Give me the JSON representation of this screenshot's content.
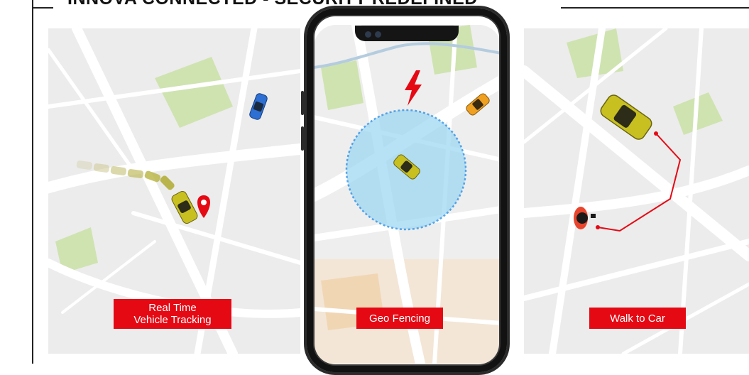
{
  "header": {
    "title": "INNOVA CONNECTED - SECURITY REDEFINED"
  },
  "features": [
    {
      "label_line1": "Real Time",
      "label_line2": "Vehicle Tracking"
    },
    {
      "label": "Geo Fencing"
    },
    {
      "label": "Walk to Car"
    }
  ],
  "colors": {
    "accent_red": "#e50914",
    "map_background": "#ececec",
    "road": "#ffffff",
    "park_green": "#cfe3b0",
    "geofence_fill": "#9fd8f2",
    "geofence_border": "#1e88e5",
    "car_yellow": "#c8c020",
    "car_blue": "#2d6fd2",
    "car_orange": "#f0a020"
  },
  "icons": [
    "location-pin-icon",
    "lightning-icon",
    "person-icon",
    "car-icon"
  ]
}
